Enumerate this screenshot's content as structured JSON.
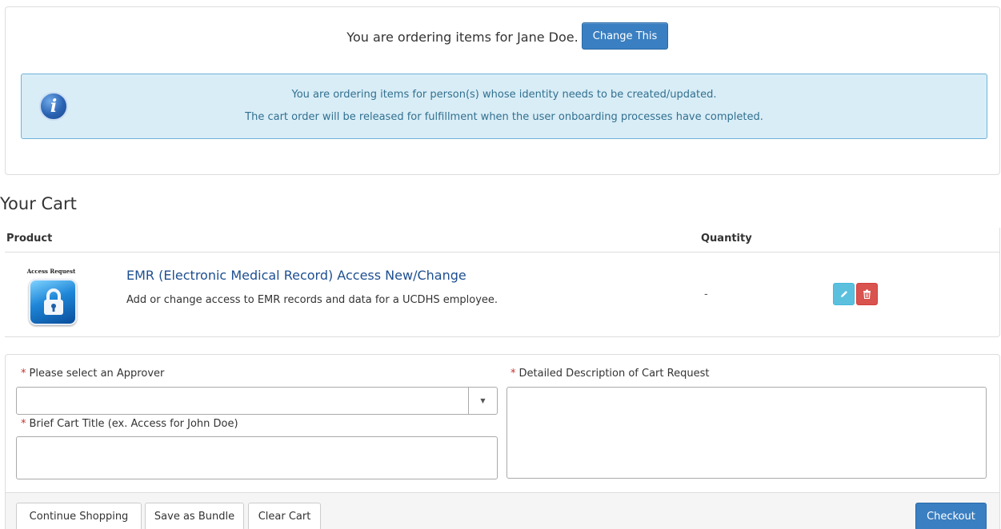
{
  "ordering": {
    "text": "You are ordering items for Jane Doe.",
    "change_label": "Change This"
  },
  "info_alert": {
    "icon": "info-icon",
    "icon_glyph": "i",
    "line1": "You are ordering items for person(s) whose identity needs to be created/updated.",
    "line2": "The cart order will be released for fulfillment when the user onboarding processes have completed."
  },
  "cart": {
    "title": "Your Cart",
    "columns": {
      "product": "Product",
      "quantity": "Quantity"
    },
    "items": [
      {
        "image_label": "Access Request",
        "image_icon": "lock-icon",
        "title": "EMR (Electronic Medical Record) Access New/Change",
        "description": "Add or change access to EMR records and data for a UCDHS employee.",
        "quantity": "-"
      }
    ]
  },
  "form": {
    "approver_label": "Please select an Approver",
    "approver_value": "",
    "cart_title_label": "Brief Cart Title (ex. Access for John Doe)",
    "cart_title_value": "",
    "description_label": "Detailed Description of Cart Request",
    "description_value": "",
    "required_marker": "*"
  },
  "footer": {
    "continue_label": "Continue Shopping",
    "bundle_label": "Save as Bundle",
    "clear_label": "Clear Cart",
    "checkout_label": "Checkout"
  },
  "colors": {
    "primary_button": "#3a7fc1",
    "info_bg": "#d9edf7",
    "info_text": "#31708f",
    "edit_button": "#5bc0de",
    "delete_button": "#d9534f",
    "required_star": "#c9302c",
    "link_title": "#1d4f91"
  }
}
